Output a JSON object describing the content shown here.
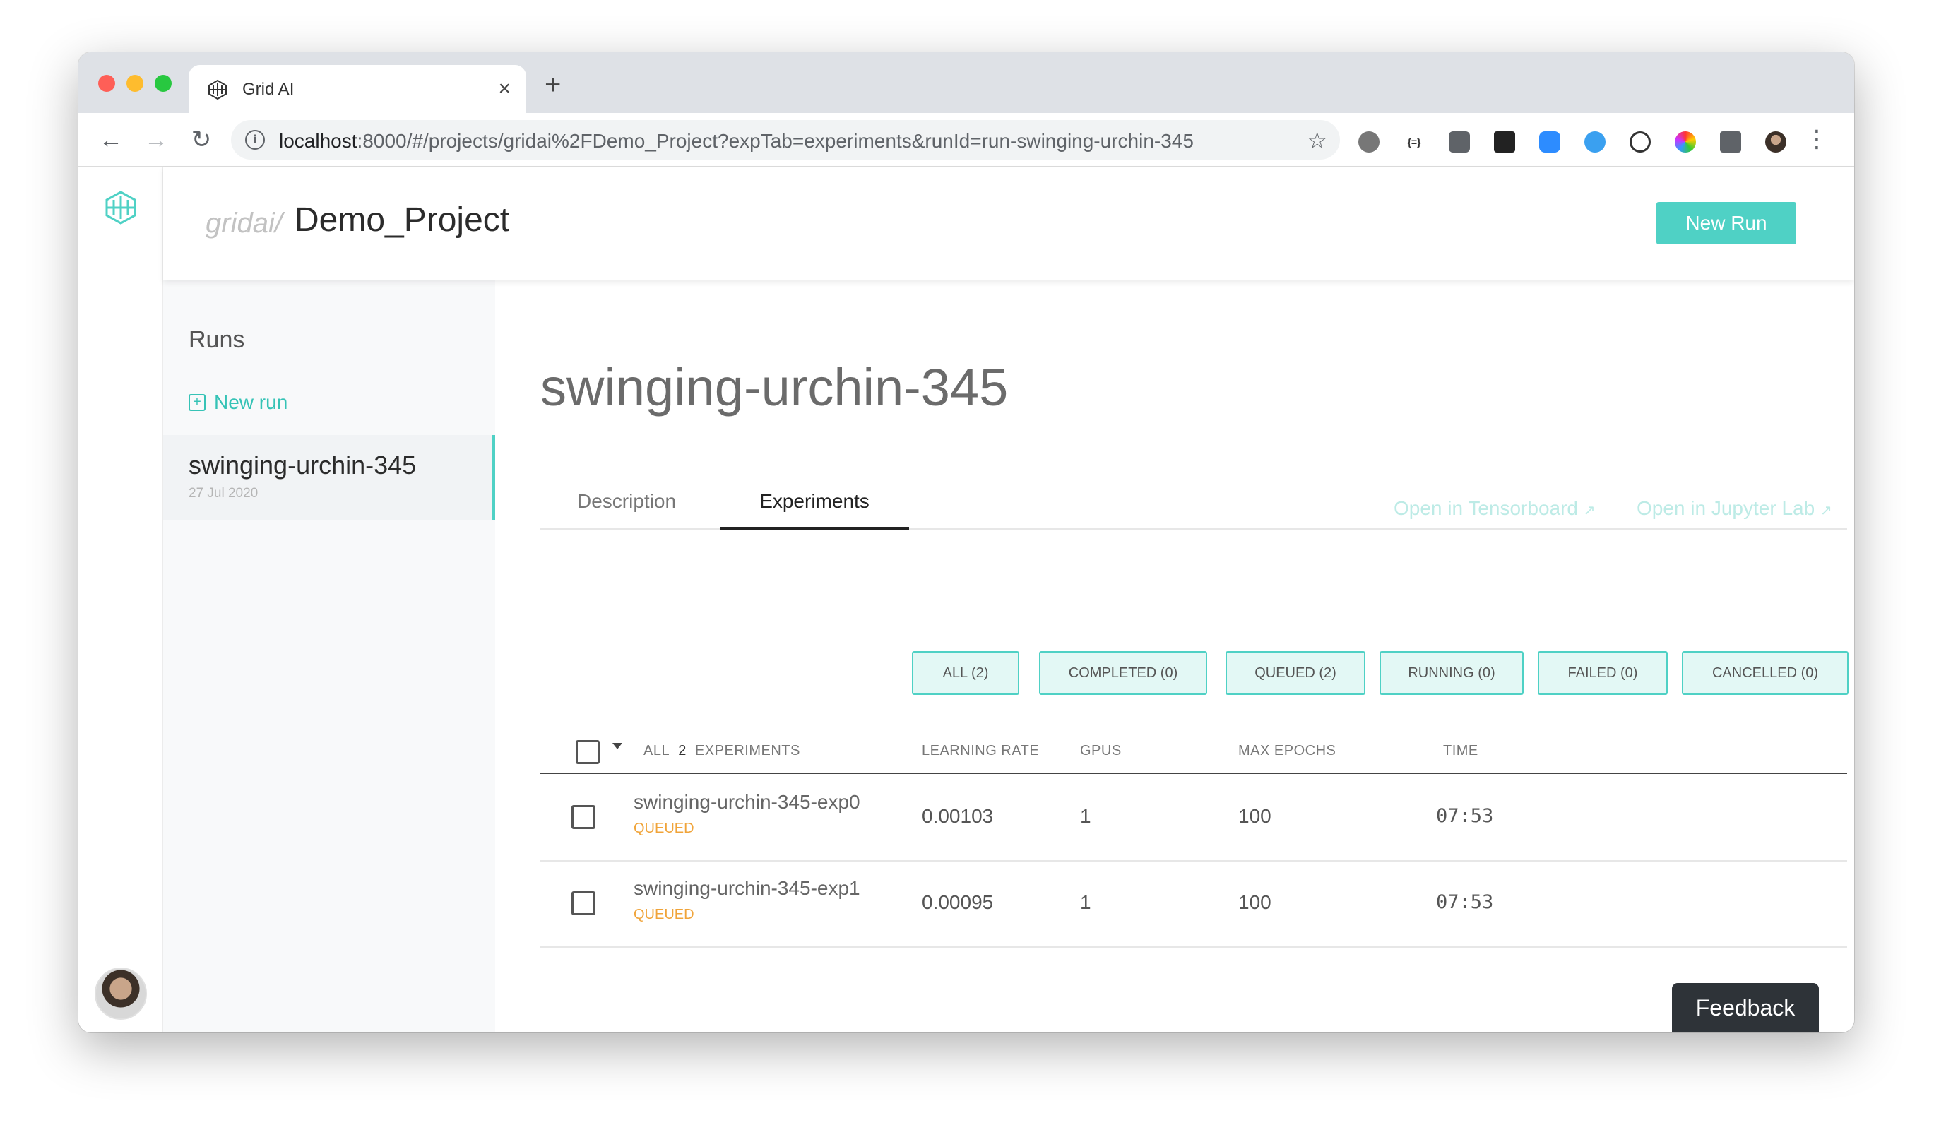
{
  "browser": {
    "tab_title": "Grid AI",
    "tab_close": "×",
    "new_tab": "+",
    "url_host": "localhost",
    "url_rest": ":8000/#/projects/gridai%2FDemo_Project?expTab=experiments&runId=run-swinging-urchin-345",
    "icons": [
      "back-icon",
      "forward-icon",
      "reload-icon",
      "info-icon",
      "star-icon",
      "extension-icons",
      "menu-icon"
    ]
  },
  "header": {
    "crumb_prefix": "gridai/",
    "project_name": "Demo_Project",
    "new_run_label": "New Run"
  },
  "sidebar": {
    "heading": "Runs",
    "new_run_link": "New run",
    "runs": [
      {
        "name": "swinging-urchin-345",
        "date": "27 Jul 2020"
      }
    ]
  },
  "main": {
    "run_title": "swinging-urchin-345",
    "tabs": [
      {
        "label": "Description",
        "active": false
      },
      {
        "label": "Experiments",
        "active": true
      }
    ],
    "links": {
      "tensorboard": "Open in Tensorboard",
      "jupyter": "Open in Jupyter Lab"
    },
    "filters": [
      "ALL (2)",
      "COMPLETED (0)",
      "QUEUED (2)",
      "RUNNING (0)",
      "FAILED (0)",
      "CANCELLED (0)"
    ],
    "table": {
      "header": {
        "all": "ALL",
        "count": "2",
        "experiments": "EXPERIMENTS",
        "learning_rate": "LEARNING RATE",
        "gpus": "GPUS",
        "max_epochs": "MAX EPOCHS",
        "time": "TIME"
      },
      "rows": [
        {
          "name": "swinging-urchin-345-exp0",
          "status": "QUEUED",
          "learning_rate": "0.00103",
          "gpus": "1",
          "max_epochs": "100",
          "time": "07:53"
        },
        {
          "name": "swinging-urchin-345-exp1",
          "status": "QUEUED",
          "learning_rate": "0.00095",
          "gpus": "1",
          "max_epochs": "100",
          "time": "07:53"
        }
      ]
    }
  },
  "feedback_label": "Feedback",
  "colors": {
    "accent": "#4fd1c5",
    "accent_text": "#36c3b6",
    "queued": "#f0a43a",
    "filter_bg": "#e3f8f5"
  }
}
